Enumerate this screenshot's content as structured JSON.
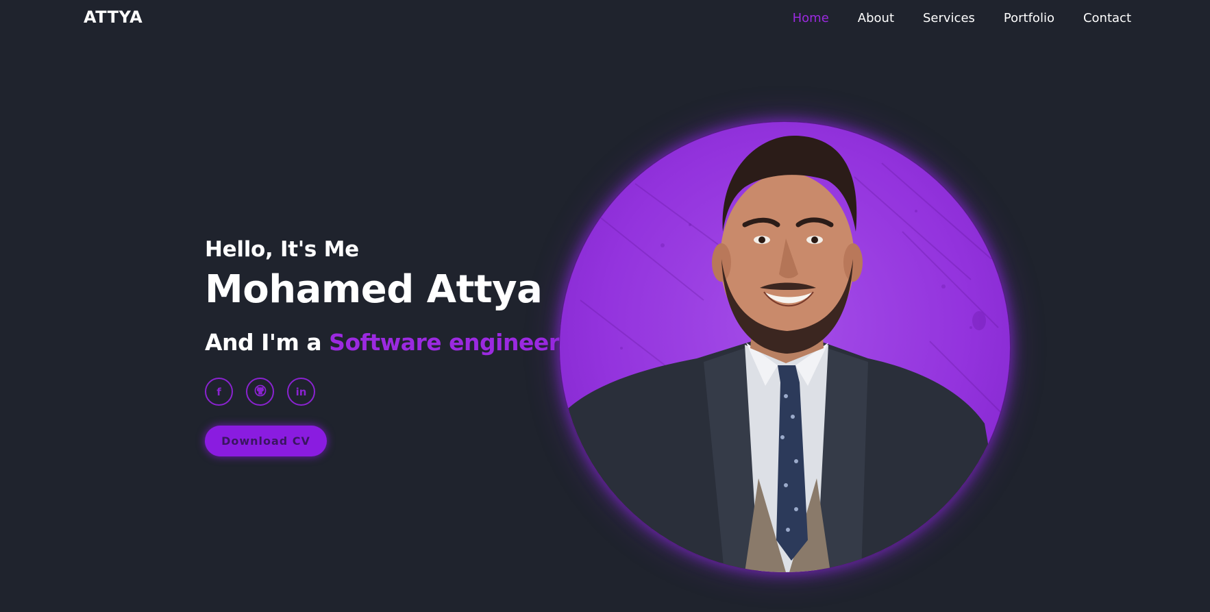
{
  "header": {
    "logo": "ATTYA",
    "nav": [
      {
        "label": "Home",
        "active": true
      },
      {
        "label": "About",
        "active": false
      },
      {
        "label": "Services",
        "active": false
      },
      {
        "label": "Portfolio",
        "active": false
      },
      {
        "label": "Contact",
        "active": false
      }
    ]
  },
  "hero": {
    "greeting": "Hello, It's Me",
    "name": "Mohamed Attya",
    "role_prefix": "And I'm a ",
    "role_highlight": "Software engineer",
    "socials": [
      {
        "icon": "facebook-icon",
        "glyph": "f"
      },
      {
        "icon": "github-icon",
        "glyph": "◉"
      },
      {
        "icon": "linkedin-icon",
        "glyph": "in"
      }
    ],
    "cv_button": "Download CV"
  },
  "colors": {
    "background": "#1f232d",
    "accent": "#9b2ae0",
    "text": "#ffffff"
  }
}
